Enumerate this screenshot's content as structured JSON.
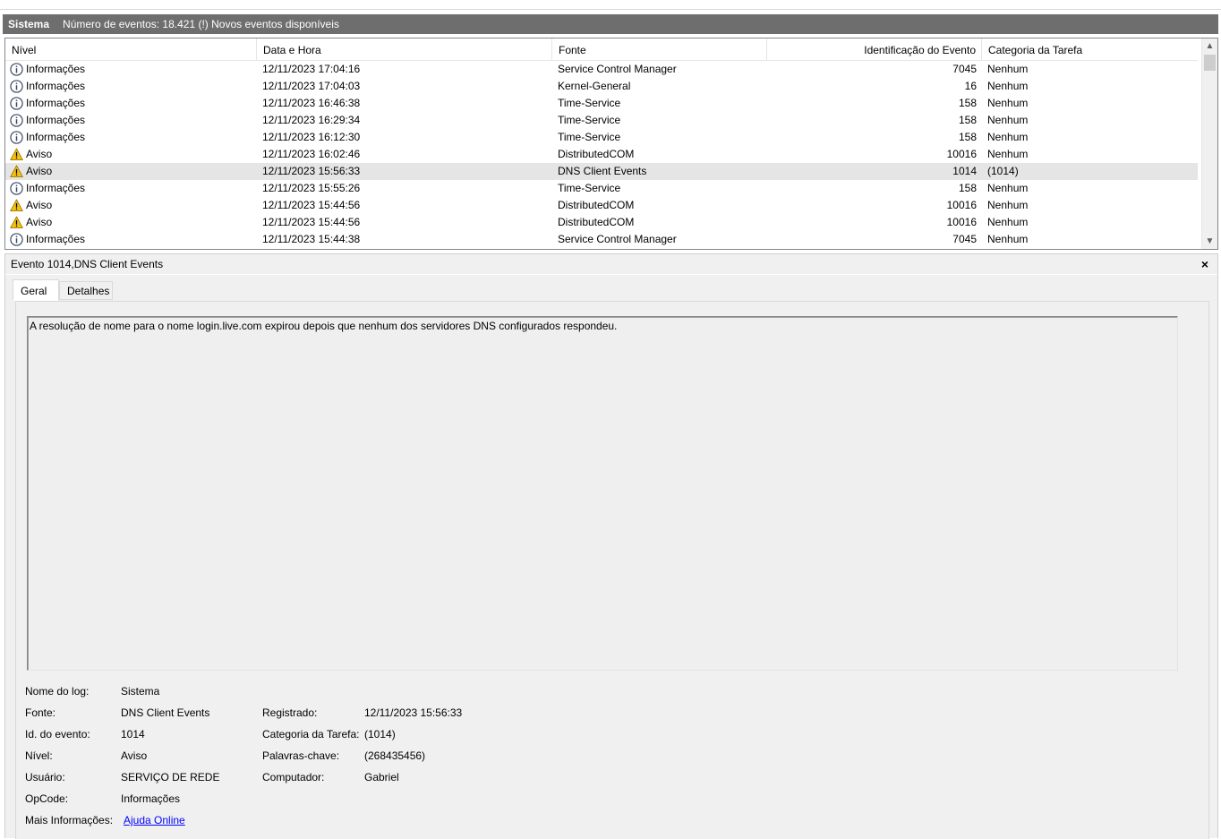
{
  "colors": {
    "title_bar_bg": "#6e6e6e",
    "selected_row": "#e5e5e5",
    "link": "#0000ff",
    "warning_icon": "#f5c211",
    "info_icon": "#3c4a66"
  },
  "title_bar": {
    "log_name": "Sistema",
    "info": "Número de eventos: 18.421 (!) Novos eventos disponíveis"
  },
  "columns": [
    "Nível",
    "Data e Hora",
    "Fonte",
    "Identificação do Evento",
    "Categoria da Tarefa"
  ],
  "events": [
    {
      "icon": "info-icon",
      "level": "Informações",
      "datetime": "12/11/2023 17:04:16",
      "source": "Service Control Manager",
      "id": "7045",
      "category": "Nenhum"
    },
    {
      "icon": "info-icon",
      "level": "Informações",
      "datetime": "12/11/2023 17:04:03",
      "source": "Kernel-General",
      "id": "16",
      "category": "Nenhum"
    },
    {
      "icon": "info-icon",
      "level": "Informações",
      "datetime": "12/11/2023 16:46:38",
      "source": "Time-Service",
      "id": "158",
      "category": "Nenhum"
    },
    {
      "icon": "info-icon",
      "level": "Informações",
      "datetime": "12/11/2023 16:29:34",
      "source": "Time-Service",
      "id": "158",
      "category": "Nenhum"
    },
    {
      "icon": "info-icon",
      "level": "Informações",
      "datetime": "12/11/2023 16:12:30",
      "source": "Time-Service",
      "id": "158",
      "category": "Nenhum"
    },
    {
      "icon": "warning-icon",
      "level": "Aviso",
      "datetime": "12/11/2023 16:02:46",
      "source": "DistributedCOM",
      "id": "10016",
      "category": "Nenhum"
    },
    {
      "icon": "warning-icon",
      "level": "Aviso",
      "datetime": "12/11/2023 15:56:33",
      "source": "DNS Client Events",
      "id": "1014",
      "category": "(1014)",
      "selected": true
    },
    {
      "icon": "info-icon",
      "level": "Informações",
      "datetime": "12/11/2023 15:55:26",
      "source": "Time-Service",
      "id": "158",
      "category": "Nenhum"
    },
    {
      "icon": "warning-icon",
      "level": "Aviso",
      "datetime": "12/11/2023 15:44:56",
      "source": "DistributedCOM",
      "id": "10016",
      "category": "Nenhum"
    },
    {
      "icon": "warning-icon",
      "level": "Aviso",
      "datetime": "12/11/2023 15:44:56",
      "source": "DistributedCOM",
      "id": "10016",
      "category": "Nenhum"
    },
    {
      "icon": "info-icon",
      "level": "Informações",
      "datetime": "12/11/2023 15:44:38",
      "source": "Service Control Manager",
      "id": "7045",
      "category": "Nenhum"
    }
  ],
  "detail": {
    "title": "Evento 1014,DNS Client Events",
    "close_label": "×",
    "tabs": [
      "Geral",
      "Detalhes"
    ],
    "description": "A resolução de nome para o nome login.live.com expirou depois que nenhum dos servidores DNS configurados respondeu.",
    "props": {
      "log_name_label": "Nome do log:",
      "log_name_value": "Sistema",
      "source_label": "Fonte:",
      "source_value": "DNS Client Events",
      "logged_label": "Registrado:",
      "logged_value": "12/11/2023 15:56:33",
      "event_id_label": "Id. do evento:",
      "event_id_value": "1014",
      "task_category_label": "Categoria da Tarefa:",
      "task_category_value": "(1014)",
      "level_label": "Nível:",
      "level_value": "Aviso",
      "keywords_label": "Palavras-chave:",
      "keywords_value": "(268435456)",
      "user_label": "Usuário:",
      "user_value": "SERVIÇO DE REDE",
      "computer_label": "Computador:",
      "computer_value": "Gabriel",
      "opcode_label": "OpCode:",
      "opcode_value": "Informações",
      "more_info_label": "Mais Informações:",
      "more_info_link": "Ajuda Online"
    }
  }
}
